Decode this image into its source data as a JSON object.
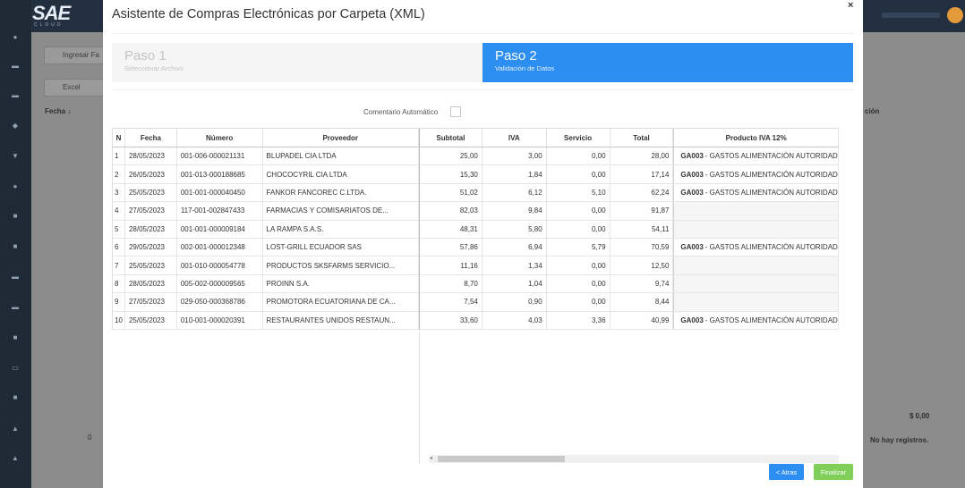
{
  "background": {
    "logo": "SAE",
    "logo_sub": "CLOUD",
    "buttons": {
      "ingresar": "Ingresar Fa",
      "excel": "Excel"
    },
    "col_fecha": "Fecha ↓",
    "col_right": "ción",
    "total": "$ 0,00",
    "no_records": "No hay registros.",
    "page_num": "0"
  },
  "modal": {
    "title": "Asistente de Compras Electrónicas por Carpeta (XML)",
    "close": "×",
    "steps": [
      {
        "title": "Paso 1",
        "subtitle": "Seleccionar Archivo"
      },
      {
        "title": "Paso 2",
        "subtitle": "Validación de Datos"
      }
    ],
    "comment_label": "Comentario Automático",
    "columns": {
      "n": "N",
      "fecha": "Fecha",
      "numero": "Número",
      "proveedor": "Proveedor",
      "subtotal": "Subtotal",
      "iva": "IVA",
      "servicio": "Servicio",
      "total": "Total",
      "producto": "Producto IVA 12%"
    },
    "rows": [
      {
        "n": "1",
        "fecha": "28/05/2023",
        "numero": "001-006-000021131",
        "proveedor": "BLUPADEL CIA LTDA",
        "subtotal": "25,00",
        "iva": "3,00",
        "servicio": "0,00",
        "total": "28,00",
        "prod_code": "GA003",
        "prod_name": " - GASTOS ALIMENTACIÓN AUTORIDAD"
      },
      {
        "n": "2",
        "fecha": "26/05/2023",
        "numero": "001-013-000188685",
        "proveedor": "CHOCOCYRIL CIA LTDA",
        "subtotal": "15,30",
        "iva": "1,84",
        "servicio": "0,00",
        "total": "17,14",
        "prod_code": "GA003",
        "prod_name": " - GASTOS ALIMENTACIÓN AUTORIDAD"
      },
      {
        "n": "3",
        "fecha": "25/05/2023",
        "numero": "001-001-000040450",
        "proveedor": "FANKOR FANCOREC C.LTDA.",
        "subtotal": "51,02",
        "iva": "6,12",
        "servicio": "5,10",
        "total": "62,24",
        "prod_code": "GA003",
        "prod_name": " - GASTOS ALIMENTACIÓN AUTORIDAD"
      },
      {
        "n": "4",
        "fecha": "27/05/2023",
        "numero": "117-001-002847433",
        "proveedor": "FARMACIAS Y COMISARIATOS DE...",
        "subtotal": "82,03",
        "iva": "9,84",
        "servicio": "0,00",
        "total": "91,87",
        "prod_code": "",
        "prod_name": ""
      },
      {
        "n": "5",
        "fecha": "28/05/2023",
        "numero": "001-001-000009184",
        "proveedor": "LA RAMPA S.A.S.",
        "subtotal": "48,31",
        "iva": "5,80",
        "servicio": "0,00",
        "total": "54,11",
        "prod_code": "",
        "prod_name": ""
      },
      {
        "n": "6",
        "fecha": "29/05/2023",
        "numero": "002-001-000012348",
        "proveedor": "LOST-GRILL ECUADOR SAS",
        "subtotal": "57,86",
        "iva": "6,94",
        "servicio": "5,79",
        "total": "70,59",
        "prod_code": "GA003",
        "prod_name": " - GASTOS ALIMENTACIÓN AUTORIDAD"
      },
      {
        "n": "7",
        "fecha": "25/05/2023",
        "numero": "001-010-000054778",
        "proveedor": "PRODUCTOS SKSFARMS SERVICIO...",
        "subtotal": "11,16",
        "iva": "1,34",
        "servicio": "0,00",
        "total": "12,50",
        "prod_code": "",
        "prod_name": ""
      },
      {
        "n": "8",
        "fecha": "28/05/2023",
        "numero": "005-002-000009565",
        "proveedor": "PROINN S.A.",
        "subtotal": "8,70",
        "iva": "1,04",
        "servicio": "0,00",
        "total": "9,74",
        "prod_code": "",
        "prod_name": ""
      },
      {
        "n": "9",
        "fecha": "27/05/2023",
        "numero": "029-050-000368786",
        "proveedor": "PROMOTORA ECUATORIANA DE CA...",
        "subtotal": "7,54",
        "iva": "0,90",
        "servicio": "0,00",
        "total": "8,44",
        "prod_code": "",
        "prod_name": ""
      },
      {
        "n": "10",
        "fecha": "25/05/2023",
        "numero": "010-001-000020391",
        "proveedor": "RESTAURANTES UNIDOS RESTAUN...",
        "subtotal": "33,60",
        "iva": "4,03",
        "servicio": "3,36",
        "total": "40,99",
        "prod_code": "GA003",
        "prod_name": " - GASTOS ALIMENTACIÓN AUTORIDAD"
      }
    ],
    "buttons": {
      "back": "< Atras",
      "finish": "Finalizar"
    }
  },
  "colors": {
    "primary": "#2b8ef0",
    "success": "#7fcf5a",
    "sidebar": "#1f2a36"
  }
}
